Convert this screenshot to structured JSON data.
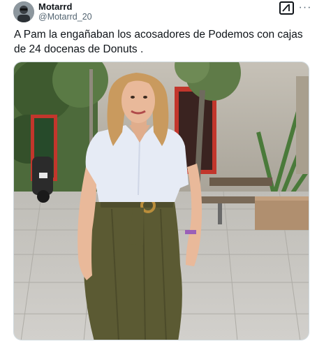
{
  "tweet": {
    "author": {
      "display_name": "Motarrd",
      "handle": "@Motarrd_20"
    },
    "text": "A Pam la engañaban los acosadores de Podemos con cajas de 24 docenas de Donuts .",
    "actions": {
      "grok_icon": "grok-icon",
      "more_icon": "more-icon"
    },
    "media": {
      "icon": "photo",
      "colors": {
        "pavement": "#c9c8c4",
        "wall": "#b9b4aa",
        "window_frame": "#c2362c",
        "blouse": "#e6ebf5",
        "skirt": "#5b5a33",
        "hair": "#c99a5e",
        "skin": "#e9b99a"
      }
    }
  }
}
